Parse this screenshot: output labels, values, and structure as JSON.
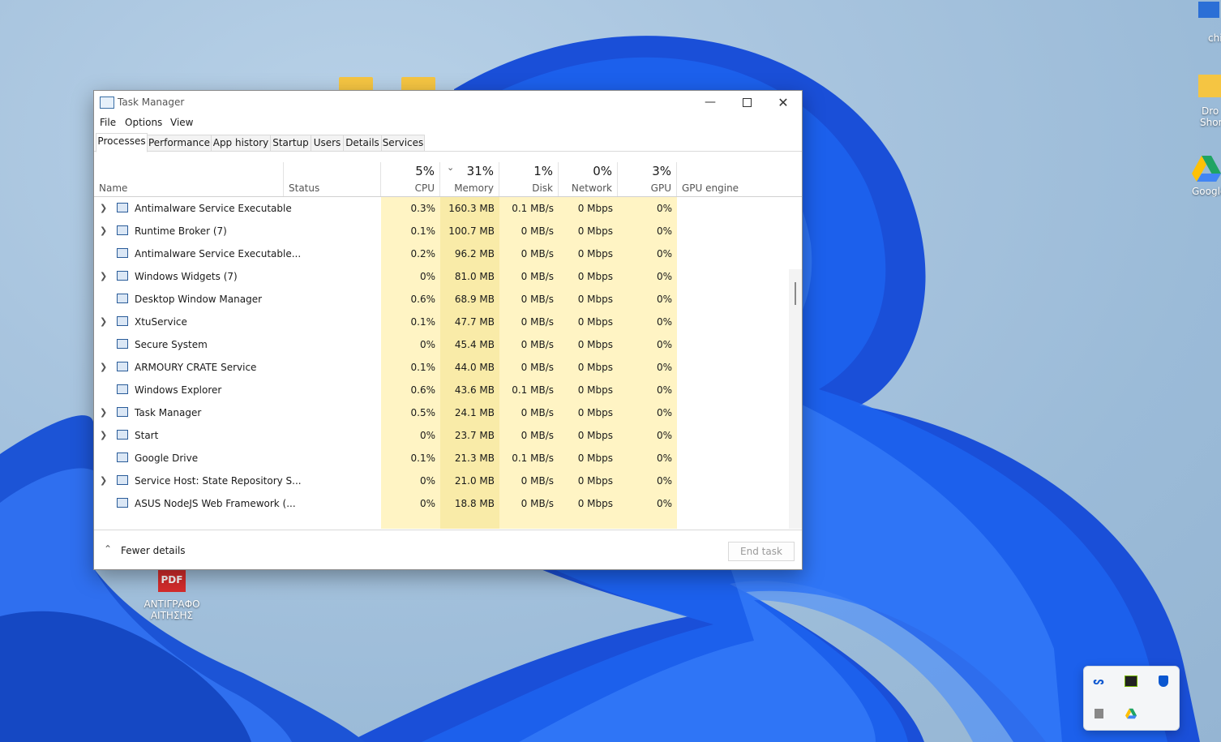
{
  "window": {
    "title": "Task Manager",
    "menu": [
      "File",
      "Options",
      "View"
    ],
    "tabs": [
      "Processes",
      "Performance",
      "App history",
      "Startup",
      "Users",
      "Details",
      "Services"
    ],
    "active_tab": "Processes"
  },
  "columns": {
    "name": "Name",
    "status": "Status",
    "cpu": {
      "pct": "5%",
      "label": "CPU"
    },
    "memory": {
      "pct": "31%",
      "label": "Memory"
    },
    "disk": {
      "pct": "1%",
      "label": "Disk"
    },
    "network": {
      "pct": "0%",
      "label": "Network"
    },
    "gpu": {
      "pct": "3%",
      "label": "GPU"
    },
    "gpu_engine": "GPU engine"
  },
  "processes": [
    {
      "name": "Antimalware Service Executable",
      "expand": true,
      "cpu": "0.3%",
      "mem": "160.3 MB",
      "disk": "0.1 MB/s",
      "net": "0 Mbps",
      "gpu": "0%"
    },
    {
      "name": "Runtime Broker (7)",
      "expand": true,
      "cpu": "0.1%",
      "mem": "100.7 MB",
      "disk": "0 MB/s",
      "net": "0 Mbps",
      "gpu": "0%"
    },
    {
      "name": "Antimalware Service Executable...",
      "expand": false,
      "cpu": "0.2%",
      "mem": "96.2 MB",
      "disk": "0 MB/s",
      "net": "0 Mbps",
      "gpu": "0%"
    },
    {
      "name": "Windows Widgets (7)",
      "expand": true,
      "cpu": "0%",
      "mem": "81.0 MB",
      "disk": "0 MB/s",
      "net": "0 Mbps",
      "gpu": "0%"
    },
    {
      "name": "Desktop Window Manager",
      "expand": false,
      "cpu": "0.6%",
      "mem": "68.9 MB",
      "disk": "0 MB/s",
      "net": "0 Mbps",
      "gpu": "0%"
    },
    {
      "name": "XtuService",
      "expand": true,
      "cpu": "0.1%",
      "mem": "47.7 MB",
      "disk": "0 MB/s",
      "net": "0 Mbps",
      "gpu": "0%"
    },
    {
      "name": "Secure System",
      "expand": false,
      "cpu": "0%",
      "mem": "45.4 MB",
      "disk": "0 MB/s",
      "net": "0 Mbps",
      "gpu": "0%"
    },
    {
      "name": "ARMOURY CRATE Service",
      "expand": true,
      "cpu": "0.1%",
      "mem": "44.0 MB",
      "disk": "0 MB/s",
      "net": "0 Mbps",
      "gpu": "0%"
    },
    {
      "name": "Windows Explorer",
      "expand": false,
      "cpu": "0.6%",
      "mem": "43.6 MB",
      "disk": "0.1 MB/s",
      "net": "0 Mbps",
      "gpu": "0%"
    },
    {
      "name": "Task Manager",
      "expand": true,
      "cpu": "0.5%",
      "mem": "24.1 MB",
      "disk": "0 MB/s",
      "net": "0 Mbps",
      "gpu": "0%"
    },
    {
      "name": "Start",
      "expand": true,
      "cpu": "0%",
      "mem": "23.7 MB",
      "disk": "0 MB/s",
      "net": "0 Mbps",
      "gpu": "0%"
    },
    {
      "name": "Google Drive",
      "expand": false,
      "cpu": "0.1%",
      "mem": "21.3 MB",
      "disk": "0.1 MB/s",
      "net": "0 Mbps",
      "gpu": "0%"
    },
    {
      "name": "Service Host: State Repository S...",
      "expand": true,
      "cpu": "0%",
      "mem": "21.0 MB",
      "disk": "0 MB/s",
      "net": "0 Mbps",
      "gpu": "0%"
    },
    {
      "name": "ASUS NodeJS Web Framework (...",
      "expand": false,
      "cpu": "0%",
      "mem": "18.8 MB",
      "disk": "0 MB/s",
      "net": "0 Mbps",
      "gpu": "0%"
    }
  ],
  "footer": {
    "fewer_details": "Fewer details",
    "end_task": "End task"
  },
  "desktop": {
    "pdf_icon_label_1": "ΑΝΤΙΓΡΑΦΟ",
    "pdf_icon_label_2": "ΑΙΤΗΣΗΣ",
    "pdf_badge": "PDF",
    "right_icon_1": "chi",
    "right_icon_2a": "Dro",
    "right_icon_2b": "Shor",
    "right_icon_3": "Google"
  },
  "colors": {
    "heat_light": "#fff4c4",
    "heat_mid": "#f9eba8",
    "accent": "#0b57d0"
  }
}
